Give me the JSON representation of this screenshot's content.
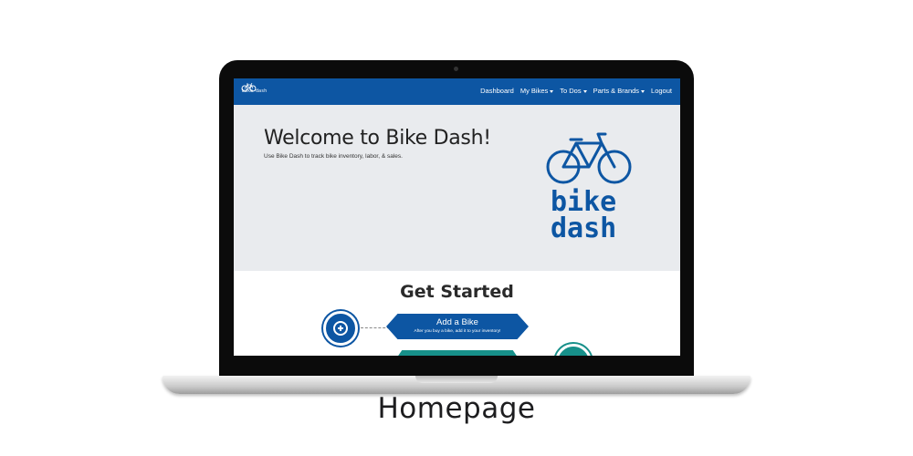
{
  "caption": "Homepage",
  "navbar": {
    "brand": "bike dash",
    "links": [
      {
        "label": "Dashboard",
        "dropdown": false
      },
      {
        "label": "My Bikes",
        "dropdown": true
      },
      {
        "label": "To Dos",
        "dropdown": true
      },
      {
        "label": "Parts & Brands",
        "dropdown": true
      },
      {
        "label": "Logout",
        "dropdown": false
      }
    ]
  },
  "hero": {
    "title": "Welcome to Bike Dash!",
    "subtitle": "Use Bike Dash to track bike inventory, labor, & sales.",
    "logo_line1": "bike",
    "logo_line2": "dash"
  },
  "get_started": {
    "title": "Get Started",
    "steps": [
      {
        "title": "Add a Bike",
        "subtitle": "After you buy a bike, add it to your inventory!",
        "icon": "plus-icon"
      }
    ]
  },
  "colors": {
    "primary": "#0d56a3",
    "teal": "#17908a",
    "hero_bg": "#e9ebee"
  }
}
